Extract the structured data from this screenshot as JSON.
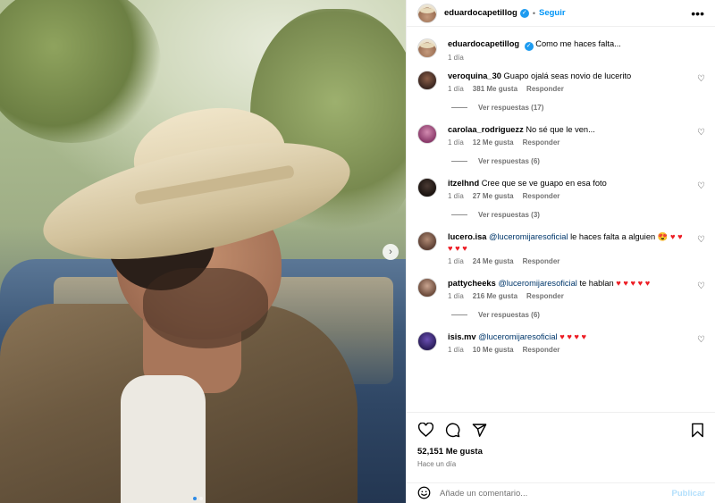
{
  "post": {
    "author": "eduardocapetillog",
    "follow_label": "Seguir",
    "bullet": "•",
    "more_icon": "more-horizontal-icon",
    "next_icon": "chevron-right-icon"
  },
  "caption": {
    "username": "eduardocapetillog",
    "text": "Como me haces falta...",
    "time": "1 día"
  },
  "comments": [
    {
      "username": "veroquina_30",
      "text": "Guapo ojalá seas novio de lucerito",
      "time": "1 día",
      "likes": "381 Me gusta",
      "reply": "Responder",
      "replies": "Ver respuestas (17)"
    },
    {
      "username": "carolaa_rodriguezz",
      "text": "No sé que le ven...",
      "time": "1 día",
      "likes": "12 Me gusta",
      "reply": "Responder",
      "replies": "Ver respuestas (6)"
    },
    {
      "username": "itzelhnd",
      "text": "Cree que se ve guapo en esa foto",
      "time": "1 día",
      "likes": "27 Me gusta",
      "reply": "Responder",
      "replies": "Ver respuestas (3)"
    },
    {
      "username": "lucero.isa",
      "mention": "@luceromijaresoficial",
      "text": "le haces falta a alguien",
      "emoji": "😍",
      "hearts": "♥ ♥ ♥ ♥ ♥",
      "time": "1 día",
      "likes": "24 Me gusta",
      "reply": "Responder"
    },
    {
      "username": "pattycheeks",
      "mention": "@luceromijaresoficial",
      "text": "te hablan",
      "hearts": "♥ ♥ ♥ ♥ ♥",
      "time": "1 día",
      "likes": "216 Me gusta",
      "reply": "Responder",
      "replies": "Ver respuestas (6)"
    },
    {
      "username": "isis.mv",
      "mention": "@luceromijaresoficial",
      "hearts": "♥ ♥ ♥ ♥",
      "time": "1 día",
      "likes": "10 Me gusta",
      "reply": "Responder"
    }
  ],
  "actions": {
    "likes": "52,151 Me gusta",
    "posted": "Hace un día"
  },
  "add_comment": {
    "placeholder": "Añade un comentario...",
    "publish_label": "Publicar"
  },
  "colors": {
    "accent": "#0095f6",
    "verified": "#1d9bf0",
    "heart": "#ed1c24"
  }
}
